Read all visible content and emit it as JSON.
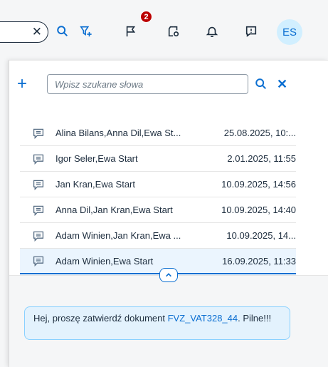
{
  "header": {
    "search_clear_icon": "close-icon",
    "icons": [
      "search-icon",
      "filter-add-icon",
      "flag-icon",
      "document-settings-icon",
      "bell-icon",
      "feedback-icon"
    ],
    "badge_count": "2",
    "avatar_initials": "ES"
  },
  "panel": {
    "add_icon": "plus-icon",
    "search": {
      "placeholder": "Wpisz szukane słowa",
      "value": ""
    },
    "list": [
      {
        "names": "Alina Bilans,Anna Dil,Ewa St...",
        "date": "25.08.2025, 10:..."
      },
      {
        "names": "Igor Seler,Ewa Start",
        "date": "2.01.2025, 11:55"
      },
      {
        "names": "Jan Kran,Ewa Start",
        "date": "10.09.2025, 14:56"
      },
      {
        "names": "Anna Dil,Jan Kran,Ewa Start",
        "date": "10.09.2025, 14:40"
      },
      {
        "names": "Adam Winien,Jan Kran,Ewa ...",
        "date": "10.09.2025, 14..."
      },
      {
        "names": "Adam Winien,Ewa Start",
        "date": "16.09.2025, 11:33",
        "selected": true
      }
    ],
    "message": {
      "text_before": "Hej, proszę zatwierdź dokument ",
      "link": "FVZ_VAT328_44",
      "text_after": ". Pilne!!!"
    }
  },
  "colors": {
    "accent": "#0a6ed1",
    "badge": "#bb0000",
    "selected_bg": "#ebf5fe",
    "bubble_bg": "#e3f2fd"
  }
}
